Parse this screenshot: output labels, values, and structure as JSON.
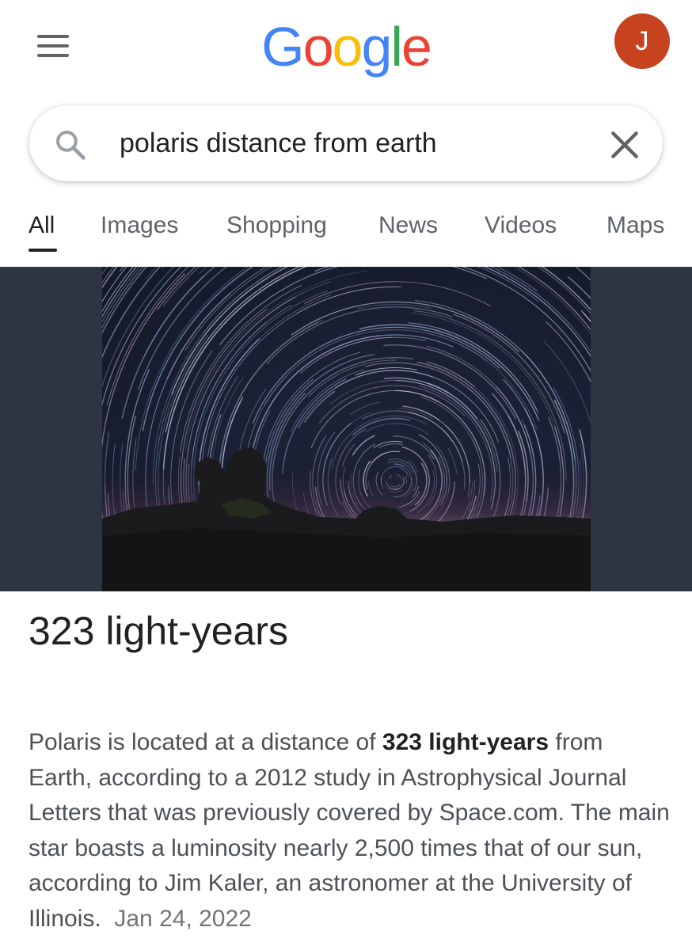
{
  "header": {
    "logo_letters": [
      "G",
      "o",
      "o",
      "g",
      "l",
      "e"
    ],
    "avatar_letter": "J",
    "avatar_color": "#c7431f"
  },
  "colors": {
    "google_blue": "#4285F4",
    "google_red": "#EA4335",
    "google_yellow": "#FBBC05",
    "google_green": "#34A853",
    "hero_background": "#2d3542"
  },
  "icons": {
    "menu": "hamburger-icon",
    "search": "search-icon",
    "clear": "close-icon"
  },
  "search": {
    "query": "polaris distance from earth"
  },
  "tabs": [
    {
      "label": "All",
      "active": true
    },
    {
      "label": "Images",
      "active": false
    },
    {
      "label": "Shopping",
      "active": false
    },
    {
      "label": "News",
      "active": false
    },
    {
      "label": "Videos",
      "active": false
    },
    {
      "label": "Maps",
      "active": false
    }
  ],
  "result": {
    "answer": "323 light-years",
    "snippet_before": "Polaris is located at a distance of ",
    "snippet_bold": "323 light-years",
    "snippet_after": " from Earth, according to a 2012 study in Astrophysical Journal Letters that was previously covered by Space.com. The main star boasts a luminosity nearly 2,500 times that of our sun, according to Jim Kaler, an astronomer at the University of Illinois.",
    "date": "Jan 24, 2022"
  }
}
